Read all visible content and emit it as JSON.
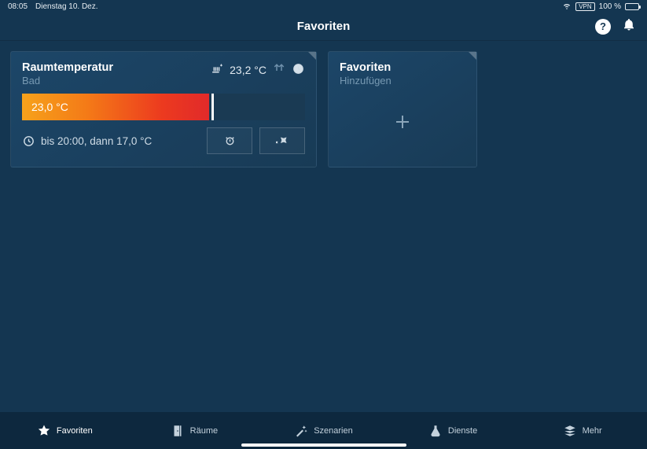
{
  "status": {
    "time": "08:05",
    "date": "Dienstag 10. Dez.",
    "vpn_label": "VPN",
    "battery_text": "100 %"
  },
  "header": {
    "title": "Favoriten"
  },
  "temp_card": {
    "title": "Raumtemperatur",
    "room": "Bad",
    "current_temp": "23,2 °C",
    "set_temp": "23,0 °C",
    "schedule_text": "bis 20:00, dann 17,0 °C"
  },
  "add_card": {
    "title": "Favoriten",
    "subtitle": "Hinzufügen"
  },
  "nav": {
    "items": [
      {
        "label": "Favoriten"
      },
      {
        "label": "Räume"
      },
      {
        "label": "Szenarien"
      },
      {
        "label": "Dienste"
      },
      {
        "label": "Mehr"
      }
    ]
  }
}
